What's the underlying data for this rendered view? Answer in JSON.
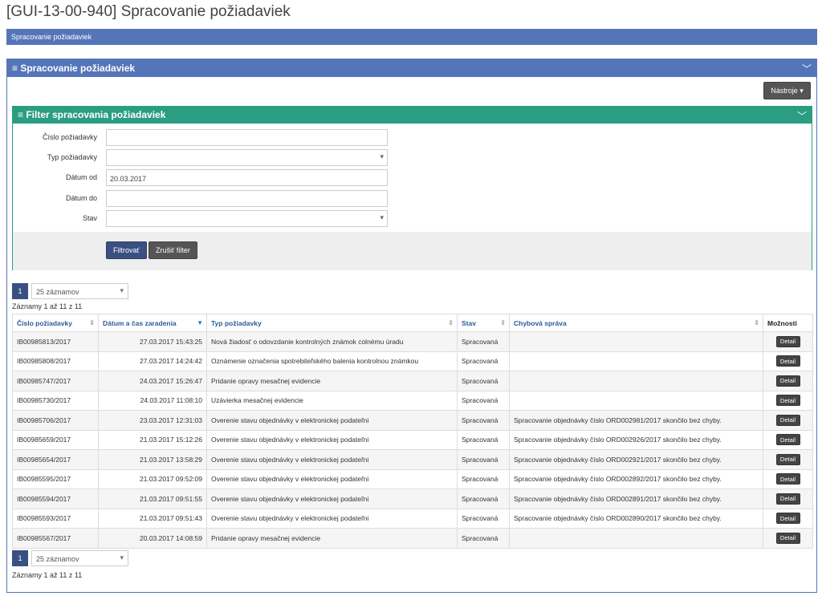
{
  "page": {
    "title": "[GUI-13-00-940] Spracovanie požiadaviek"
  },
  "breadcrumb": {
    "label": "Spracovanie požiadaviek"
  },
  "main_panel": {
    "title": "≡ Spracovanie požiadaviek",
    "collapse_icon": "chevron-down-icon"
  },
  "tools_button": {
    "label": "Nástroje ▾"
  },
  "filter": {
    "title": "≡ Filter spracovania požiadaviek",
    "fields": {
      "request_number": {
        "label": "Číslo požiadavky",
        "value": ""
      },
      "request_type": {
        "label": "Typ požiadavky",
        "value": ""
      },
      "date_from": {
        "label": "Dátum od",
        "value": "20.03.2017"
      },
      "date_to": {
        "label": "Dátum do",
        "value": ""
      },
      "status": {
        "label": "Stav",
        "value": ""
      }
    },
    "filter_button": "Filtrovať",
    "clear_button": "Zrušiť filter"
  },
  "pagination": {
    "current_page": "1",
    "page_size": "25 záznamov",
    "records_text": "Záznamy 1 až 11 z 11"
  },
  "table": {
    "columns": [
      "Číslo požiadavky",
      "Dátum a čas zaradenia",
      "Typ požiadavky",
      "Stav",
      "Chybová správa",
      "Možnosti"
    ],
    "sort_column": "Dátum a čas zaradenia",
    "detail_label": "Detail",
    "rows": [
      {
        "id": "IB00985813/2017",
        "datetime": "27.03.2017 15:43:25",
        "type": "Nová žiadosť o odovzdanie kontrolných známok colnému úradu",
        "status": "Spracovaná",
        "error": ""
      },
      {
        "id": "IB00985808/2017",
        "datetime": "27.03.2017 14:24:42",
        "type": "Oznámenie označenia spotrebiteľského balenia kontrolnou známkou",
        "status": "Spracovaná",
        "error": ""
      },
      {
        "id": "IB00985747/2017",
        "datetime": "24.03.2017 15:26:47",
        "type": "Pridanie opravy mesačnej evidencie",
        "status": "Spracovaná",
        "error": ""
      },
      {
        "id": "IB00985730/2017",
        "datetime": "24.03.2017 11:08:10",
        "type": "Uzávierka mesačnej evidencie",
        "status": "Spracovaná",
        "error": ""
      },
      {
        "id": "IB00985706/2017",
        "datetime": "23.03.2017 12:31:03",
        "type": "Overenie stavu objednávky v elektronickej podateľni",
        "status": "Spracovaná",
        "error": "Spracovanie objednávky číslo ORD002981/2017 skončilo bez chyby."
      },
      {
        "id": "IB00985659/2017",
        "datetime": "21.03.2017 15:12:26",
        "type": "Overenie stavu objednávky v elektronickej podateľni",
        "status": "Spracovaná",
        "error": "Spracovanie objednávky číslo ORD002926/2017 skončilo bez chyby."
      },
      {
        "id": "IB00985654/2017",
        "datetime": "21.03.2017 13:58:29",
        "type": "Overenie stavu objednávky v elektronickej podateľni",
        "status": "Spracovaná",
        "error": "Spracovanie objednávky číslo ORD002921/2017 skončilo bez chyby."
      },
      {
        "id": "IB00985595/2017",
        "datetime": "21.03.2017 09:52:09",
        "type": "Overenie stavu objednávky v elektronickej podateľni",
        "status": "Spracovaná",
        "error": "Spracovanie objednávky číslo ORD002892/2017 skončilo bez chyby."
      },
      {
        "id": "IB00985594/2017",
        "datetime": "21.03.2017 09:51:55",
        "type": "Overenie stavu objednávky v elektronickej podateľni",
        "status": "Spracovaná",
        "error": "Spracovanie objednávky číslo ORD002891/2017 skončilo bez chyby."
      },
      {
        "id": "IB00985593/2017",
        "datetime": "21.03.2017 09:51:43",
        "type": "Overenie stavu objednávky v elektronickej podateľni",
        "status": "Spracovaná",
        "error": "Spracovanie objednávky číslo ORD002890/2017 skončilo bez chyby."
      },
      {
        "id": "IB00985567/2017",
        "datetime": "20.03.2017 14:08:59",
        "type": "Pridanie opravy mesačnej evidencie",
        "status": "Spracovaná",
        "error": ""
      }
    ]
  },
  "colors": {
    "header_blue": "#5575b9",
    "filter_green": "#2a9d82",
    "primary_button": "#3a4f82",
    "dark_button": "#555555"
  }
}
